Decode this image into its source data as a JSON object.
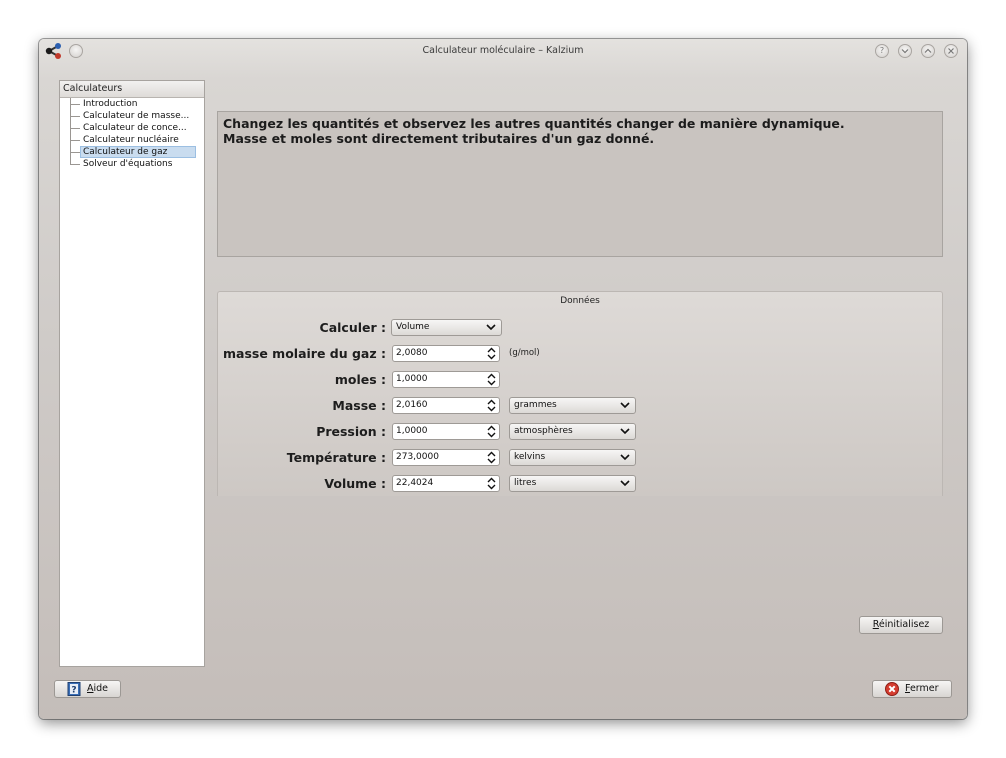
{
  "window": {
    "title": "Calculateur moléculaire – Kalzium",
    "help_button": "?"
  },
  "sidebar": {
    "header": "Calculateurs",
    "items": [
      {
        "label": "Introduction"
      },
      {
        "label": "Calculateur de masse..."
      },
      {
        "label": "Calculateur de conce..."
      },
      {
        "label": "Calculateur nucléaire"
      },
      {
        "label": "Calculateur de gaz",
        "selected": true
      },
      {
        "label": "Solveur d'équations"
      }
    ]
  },
  "description": {
    "line1": "Changez les quantités et observez les autres quantités changer de manière dynamique.",
    "line2": "Masse et moles sont directement tributaires d'un gaz donné."
  },
  "group": {
    "title": "Données",
    "calculer": {
      "label": "Calculer :",
      "value": "Volume"
    },
    "masse_molaire": {
      "label": "masse molaire du gaz :",
      "value": "2,0080",
      "unit": "(g/mol)"
    },
    "moles": {
      "label": "moles :",
      "value": "1,0000"
    },
    "masse": {
      "label": "Masse :",
      "value": "2,0160",
      "unit": "grammes"
    },
    "pression": {
      "label": "Pression :",
      "value": "1,0000",
      "unit": "atmosphères"
    },
    "temperature": {
      "label": "Température :",
      "value": "273,0000",
      "unit": "kelvins"
    },
    "volume": {
      "label": "Volume :",
      "value": "22,4024",
      "unit": "litres"
    }
  },
  "buttons": {
    "reset": {
      "mnemonic": "R",
      "rest": "éinitialisez"
    },
    "help": {
      "mnemonic": "A",
      "rest": "ide"
    },
    "close": {
      "mnemonic": "F",
      "rest": "ermer"
    }
  },
  "colors": {
    "selection": "#c9dcef",
    "close_icon": "#d43c2f",
    "help_icon": "#3a6fb8"
  }
}
